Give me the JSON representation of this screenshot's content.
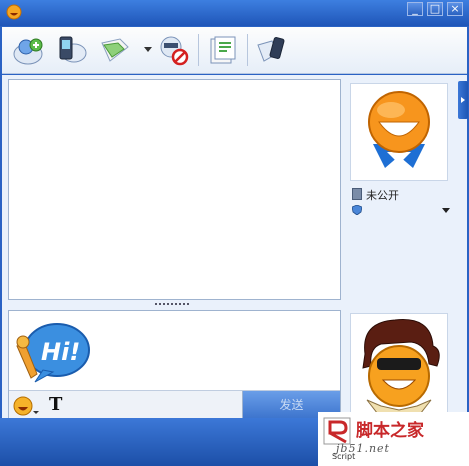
{
  "titlebar": {
    "controls": {
      "minimize": "_",
      "maximize": "□",
      "close": "×"
    },
    "icon": "app-smiley-icon"
  },
  "toolbar": {
    "buttons": [
      {
        "name": "add-contact",
        "icon": "add-contact-icon"
      },
      {
        "name": "send-sms",
        "icon": "mobile-chat-icon"
      },
      {
        "name": "send-file",
        "icon": "folder-share-icon"
      },
      {
        "name": "block",
        "icon": "block-user-icon"
      },
      {
        "name": "history",
        "icon": "chat-history-icon"
      },
      {
        "name": "mobile",
        "icon": "mobile-phone-icon"
      }
    ]
  },
  "contact": {
    "status": "未公开",
    "status_icon": "computer-status-icon"
  },
  "input": {
    "send_label": "发送",
    "font_label": "T"
  },
  "watermark": {
    "site_name": "脚本之家",
    "domain": "jb51.net",
    "script_label": "Script"
  },
  "colors": {
    "window_blue": "#2a62c4",
    "panel_bg": "#eaf1fb",
    "watermark_red": "#c8282a"
  }
}
